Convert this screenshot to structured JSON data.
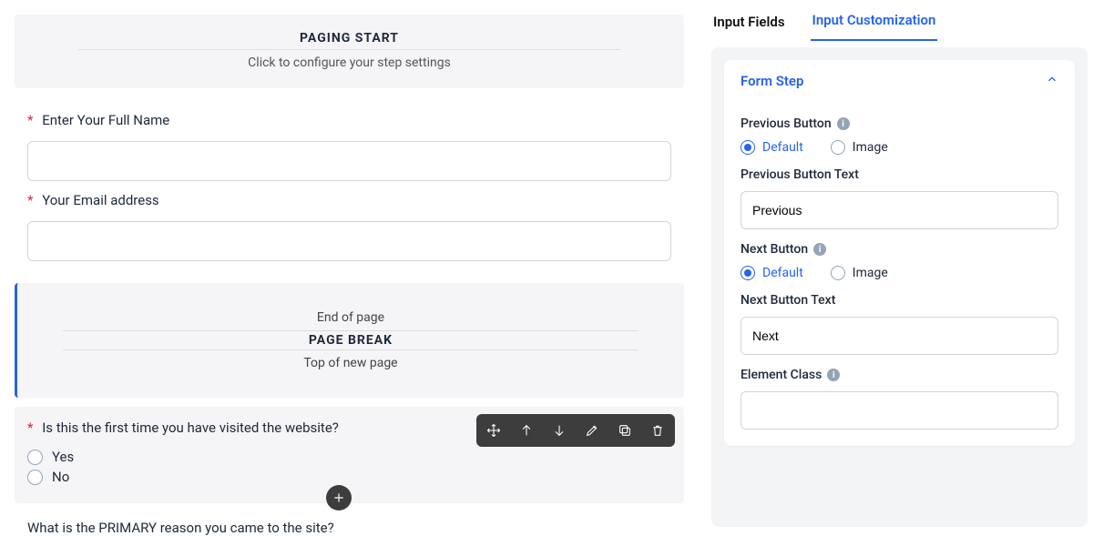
{
  "canvas": {
    "paging_start": {
      "title": "PAGING START",
      "subtitle": "Click to configure your step settings"
    },
    "fields": {
      "full_name": {
        "label": "Enter Your Full Name",
        "required": true,
        "value": ""
      },
      "email": {
        "label": "Your Email address",
        "required": true,
        "value": ""
      }
    },
    "page_break": {
      "end_text": "End of page",
      "title": "PAGE BREAK",
      "start_text": "Top of new page"
    },
    "selected_question": {
      "label": "Is this the first time you have visited the website?",
      "required": true,
      "options": [
        "Yes",
        "No"
      ]
    },
    "next_question": {
      "label": "What is the PRIMARY reason you came to the site?"
    },
    "toolbar_icons": [
      "move",
      "arrow-up",
      "arrow-down",
      "edit",
      "copy",
      "trash"
    ]
  },
  "right": {
    "tabs": {
      "input_fields": "Input Fields",
      "input_customization": "Input Customization",
      "active": "input_customization"
    },
    "card_title": "Form Step",
    "prev_button": {
      "label": "Previous Button",
      "options": {
        "default": "Default",
        "image": "Image"
      },
      "selected": "default",
      "text_label": "Previous Button Text",
      "text_value": "Previous"
    },
    "next_button": {
      "label": "Next Button",
      "options": {
        "default": "Default",
        "image": "Image"
      },
      "selected": "default",
      "text_label": "Next Button Text",
      "text_value": "Next"
    },
    "element_class": {
      "label": "Element Class",
      "value": ""
    }
  }
}
